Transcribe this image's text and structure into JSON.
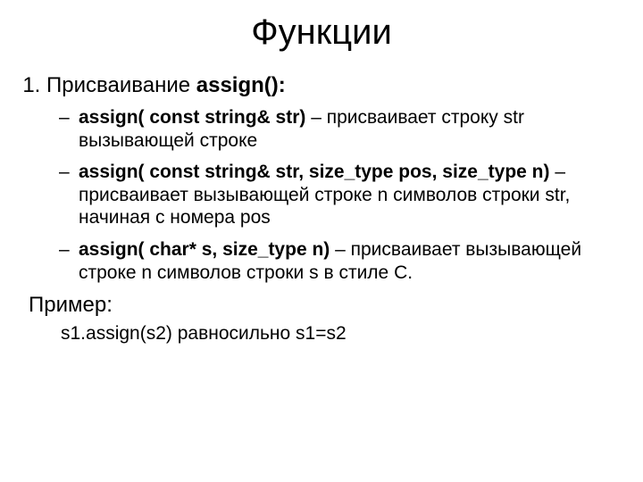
{
  "title": "Функции",
  "item1": {
    "lead": "Присваивание ",
    "strong": "assign():"
  },
  "bullets": [
    {
      "sig": " assign( const string& str)",
      "desc": " – присваивает строку str вызывающей строке"
    },
    {
      "sig": "assign( const string& str, size_type pos, size_type n)",
      "desc": " – присваивает вызывающей строке n символов строки str, начиная с номера pos"
    },
    {
      "sig": "assign( char* s, size_type n)",
      "desc": " – присваивает вызывающей строке n символов строки s в стиле С."
    }
  ],
  "example": {
    "label": "Пример:",
    "body": "s1.assign(s2) равносильно s1=s2"
  }
}
